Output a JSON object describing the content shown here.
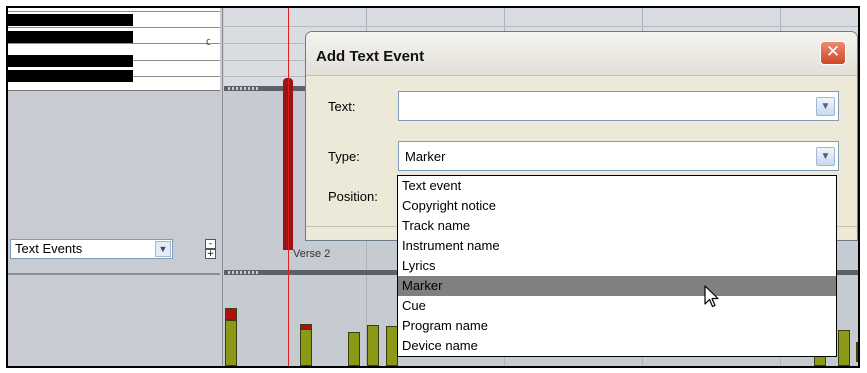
{
  "piano": {
    "c_label": "C"
  },
  "lane": {
    "selected": "Text Events",
    "collapse_label": "-",
    "expand_label": "+"
  },
  "timeline": {
    "verse_label": "Verse 2"
  },
  "dialog": {
    "title": "Add Text Event",
    "close_glyph": "✕",
    "text_label": "Text:",
    "text_value": "",
    "type_label": "Type:",
    "type_value": "Marker",
    "position_label": "Position:"
  },
  "dropdown": {
    "options": [
      "Text event",
      "Copyright notice",
      "Track name",
      "Instrument name",
      "Lyrics",
      "Marker",
      "Cue",
      "Program name",
      "Device name"
    ],
    "highlighted": "Marker"
  },
  "colors": {
    "note_olive": "#8a9a16",
    "note_red": "#b01010",
    "selection_gray": "#808080"
  },
  "icons": {
    "combo_arrow": "chevron-down-icon",
    "pointer": "mouse-pointer-icon"
  }
}
